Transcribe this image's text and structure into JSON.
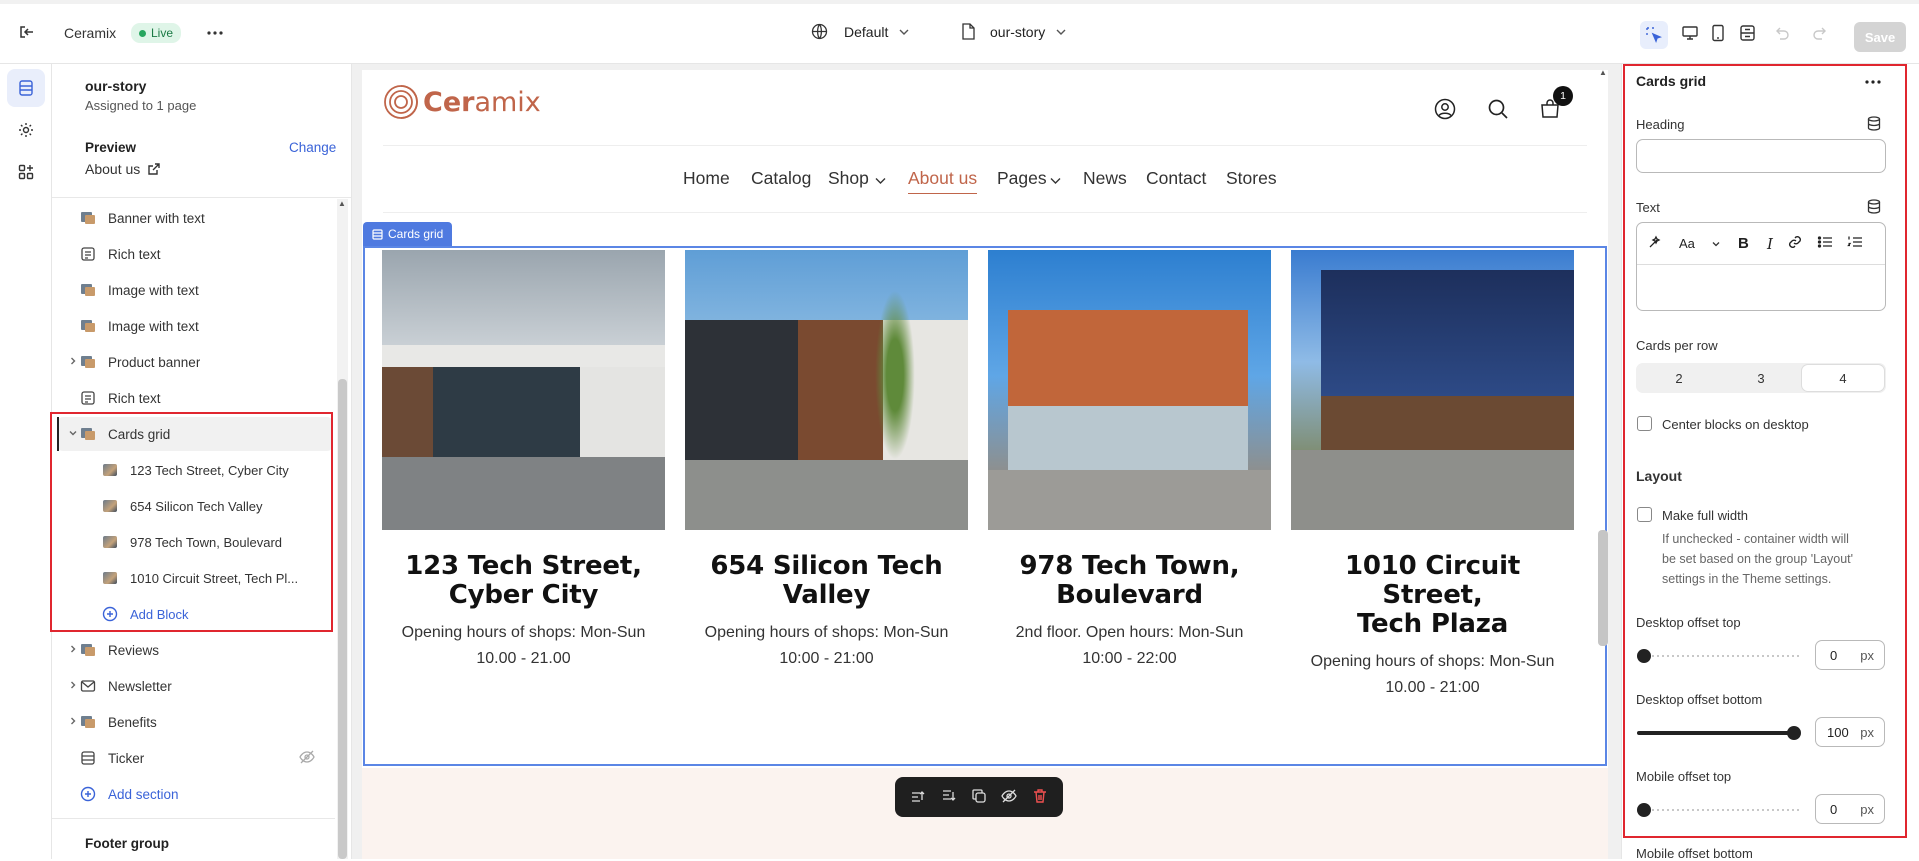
{
  "topbar": {
    "store_name": "Ceramix",
    "status": "Live",
    "theme_selector": "Default",
    "template_selector": "our-story",
    "save_label": "Save"
  },
  "left": {
    "template_name": "our-story",
    "assigned": "Assigned to 1 page",
    "preview_label": "Preview",
    "change_label": "Change",
    "preview_page": "About us",
    "sections": [
      {
        "label": "Banner with text",
        "icon": "image-icon"
      },
      {
        "label": "Rich text",
        "icon": "text-icon"
      },
      {
        "label": "Image with text",
        "icon": "image-icon"
      },
      {
        "label": "Image with text",
        "icon": "image-icon"
      },
      {
        "label": "Product banner",
        "icon": "image-icon"
      },
      {
        "label": "Rich text",
        "icon": "text-icon"
      },
      {
        "label": "Cards grid",
        "icon": "image-icon"
      }
    ],
    "blocks": [
      "123 Tech Street, Cyber City",
      "654 Silicon Tech Valley",
      "978 Tech Town, Boulevard",
      "1010 Circuit Street, Tech Pl..."
    ],
    "add_block": "Add Block",
    "more_sections": [
      {
        "label": "Reviews"
      },
      {
        "label": "Newsletter"
      },
      {
        "label": "Benefits"
      },
      {
        "label": "Ticker"
      }
    ],
    "add_section": "Add section",
    "footer_group": "Footer group"
  },
  "preview": {
    "logo": {
      "prefix": "Cer",
      "suffix": "amix"
    },
    "cart_count": "1",
    "nav": [
      "Home",
      "Catalog",
      "Shop",
      "About us",
      "Pages",
      "News",
      "Contact",
      "Stores"
    ],
    "section_tag": "Cards grid",
    "cards": [
      {
        "title_1": "123 Tech Street,",
        "title_2": "Cyber City",
        "text_1": "Opening hours of shops: Mon-Sun",
        "text_2": "10.00 - 21.00"
      },
      {
        "title_1": "654 Silicon Tech",
        "title_2": "Valley",
        "text_1": "Opening hours of shops: Mon-Sun",
        "text_2": "10:00 - 21:00"
      },
      {
        "title_1": "978 Tech Town,",
        "title_2": "Boulevard",
        "text_1": "2nd floor. Open hours: Mon-Sun",
        "text_2": "10:00 - 22:00"
      },
      {
        "title_1": "1010 Circuit Street,",
        "title_2": "Tech Plaza",
        "text_1": "Opening hours of shops: Mon-Sun",
        "text_2": "10.00 - 21:00"
      }
    ]
  },
  "settings": {
    "title": "Cards grid",
    "heading_label": "Heading",
    "heading_value": "",
    "text_label": "Text",
    "cards_per_row_label": "Cards per row",
    "cards_per_row_options": [
      "2",
      "3",
      "4"
    ],
    "cards_per_row_selected": "4",
    "center_blocks_label": "Center blocks on desktop",
    "layout_heading": "Layout",
    "full_width_label": "Make full width",
    "full_width_help_1": "If unchecked - container width will",
    "full_width_help_2": "be set based on the group 'Layout'",
    "full_width_help_3": "settings in the Theme settings.",
    "desktop_offset_top_label": "Desktop offset top",
    "desktop_offset_top": "0",
    "desktop_offset_bottom_label": "Desktop offset bottom",
    "desktop_offset_bottom": "100",
    "mobile_offset_top_label": "Mobile offset top",
    "mobile_offset_top": "0",
    "mobile_offset_bottom_label": "Mobile offset bottom",
    "unit": "px"
  },
  "colors": {
    "accent": "#4f7ae0",
    "brand": "#c0654a",
    "highlight": "#e0262f"
  }
}
